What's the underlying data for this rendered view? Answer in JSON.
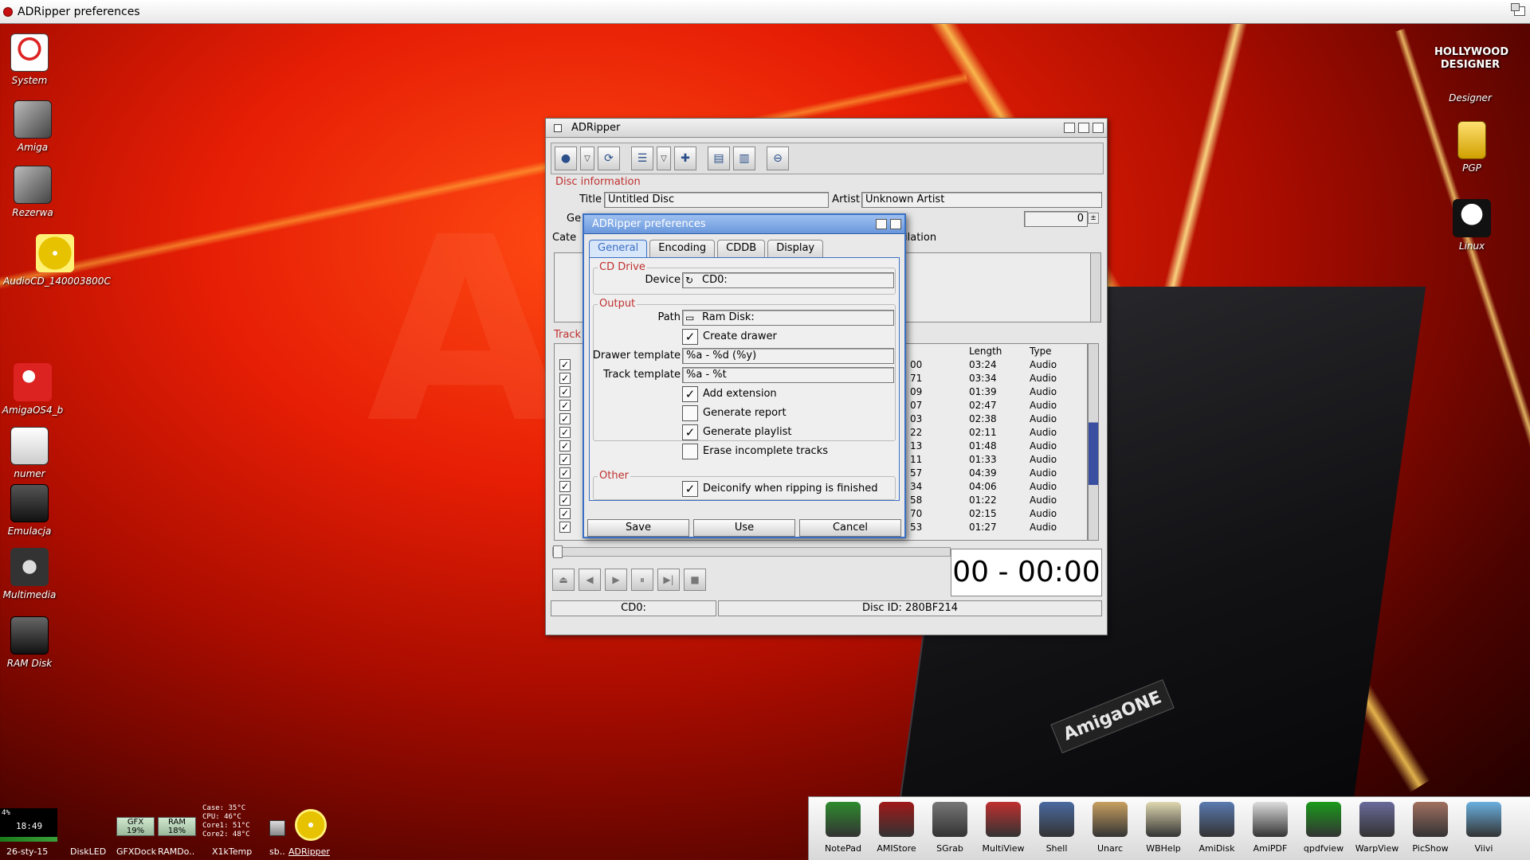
{
  "screen": {
    "title": "ADRipper preferences"
  },
  "desktop_left": [
    {
      "label": "System",
      "icon": "system-drive-icon"
    },
    {
      "label": "Amiga",
      "icon": "tools-icon"
    },
    {
      "label": "Rezerwa",
      "icon": "tools-icon"
    },
    {
      "label": "AudioCD_140003800C",
      "icon": "audio-cd-icon"
    },
    {
      "label": "AmigaOS4_b",
      "icon": "boing-ball-icon"
    },
    {
      "label": "numer",
      "icon": "document-icon"
    },
    {
      "label": "Emulacja",
      "icon": "gamepad-icon"
    },
    {
      "label": "Multimedia",
      "icon": "film-reel-icon"
    },
    {
      "label": "RAM Disk",
      "icon": "ram-disk-icon"
    }
  ],
  "desktop_right": [
    {
      "label": "Designer",
      "icon": "hollywood-designer-icon",
      "art": "HOLLYWOOD DESIGNER"
    },
    {
      "label": "PGP",
      "icon": "padlock-icon"
    },
    {
      "label": "Linux",
      "icon": "tux-icon"
    }
  ],
  "main_window": {
    "title": "ADRipper",
    "disc_info_label": "Disc information",
    "title_label": "Title",
    "title_value": "Untitled Disc",
    "artist_label": "Artist",
    "artist_value": "Unknown Artist",
    "genre_label_partial": "Ge",
    "category_label_partial": "Cate",
    "year_value": "0",
    "compilation_partial": "ilation",
    "tracks_label_partial": "Track",
    "columns": {
      "length": "Length",
      "type": "Type"
    },
    "tracks": [
      {
        "num_tail": "00",
        "length": "03:24",
        "type": "Audio"
      },
      {
        "num_tail": "71",
        "length": "03:34",
        "type": "Audio"
      },
      {
        "num_tail": "09",
        "length": "01:39",
        "type": "Audio"
      },
      {
        "num_tail": "07",
        "length": "02:47",
        "type": "Audio"
      },
      {
        "num_tail": "03",
        "length": "02:38",
        "type": "Audio"
      },
      {
        "num_tail": "22",
        "length": "02:11",
        "type": "Audio"
      },
      {
        "num_tail": "13",
        "length": "01:48",
        "type": "Audio"
      },
      {
        "num_tail": "11",
        "length": "01:33",
        "type": "Audio"
      },
      {
        "num_tail": "57",
        "length": "04:39",
        "type": "Audio"
      },
      {
        "num_tail": "34",
        "length": "04:06",
        "type": "Audio"
      },
      {
        "num_tail": "58",
        "length": "01:22",
        "type": "Audio"
      },
      {
        "num_tail": "70",
        "length": "02:15",
        "type": "Audio"
      },
      {
        "num_tail": "53",
        "length": "01:27",
        "type": "Audio"
      }
    ],
    "timer": "00 - 00:00",
    "status_device": "CD0:",
    "status_disc_id": "Disc ID: 280BF214"
  },
  "prefs": {
    "title": "ADRipper preferences",
    "tabs": [
      "General",
      "Encoding",
      "CDDB",
      "Display"
    ],
    "active_tab": "General",
    "cd_drive_label": "CD Drive",
    "device_label": "Device",
    "device_value": "CD0:",
    "output_label": "Output",
    "path_label": "Path",
    "path_value": "Ram Disk:",
    "create_drawer": "Create drawer",
    "drawer_template_label": "Drawer template",
    "drawer_template_value": "%a - %d (%y)",
    "track_template_label": "Track template",
    "track_template_value": "%a - %t",
    "add_extension": "Add extension",
    "generate_report": "Generate report",
    "generate_playlist": "Generate playlist",
    "erase_incomplete": "Erase incomplete tracks",
    "other_label": "Other",
    "deiconify": "Deiconify when ripping is finished",
    "checks": {
      "create_drawer": true,
      "add_extension": true,
      "generate_report": false,
      "generate_playlist": true,
      "erase_incomplete": false,
      "deiconify": true
    },
    "buttons": {
      "save": "Save",
      "use": "Use",
      "cancel": "Cancel"
    }
  },
  "bottom_left": {
    "clock": "18:49",
    "clock_pct": "4%",
    "date": "26-sty-15",
    "diskled": "DiskLED",
    "gfx_label": "GFX",
    "gfx_value": "19%",
    "ram_label": "RAM",
    "ram_value": "18%",
    "gfxdock": "GFXDock",
    "ramdo": "RAMDo..",
    "temps": [
      "Case: 35°C",
      "CPU: 46°C",
      "Core1: 51°C",
      "Core2: 48°C"
    ],
    "x1ktemp": "X1kTemp",
    "sb": "sb..",
    "adripper": "ADRipper"
  },
  "dock": [
    "NotePad",
    "AMIStore",
    "SGrab",
    "MultiView",
    "Shell",
    "Unarc",
    "WBHelp",
    "AmiDisk",
    "AmiPDF",
    "qpdfview",
    "WarpView",
    "PicShow",
    "Viivi"
  ]
}
